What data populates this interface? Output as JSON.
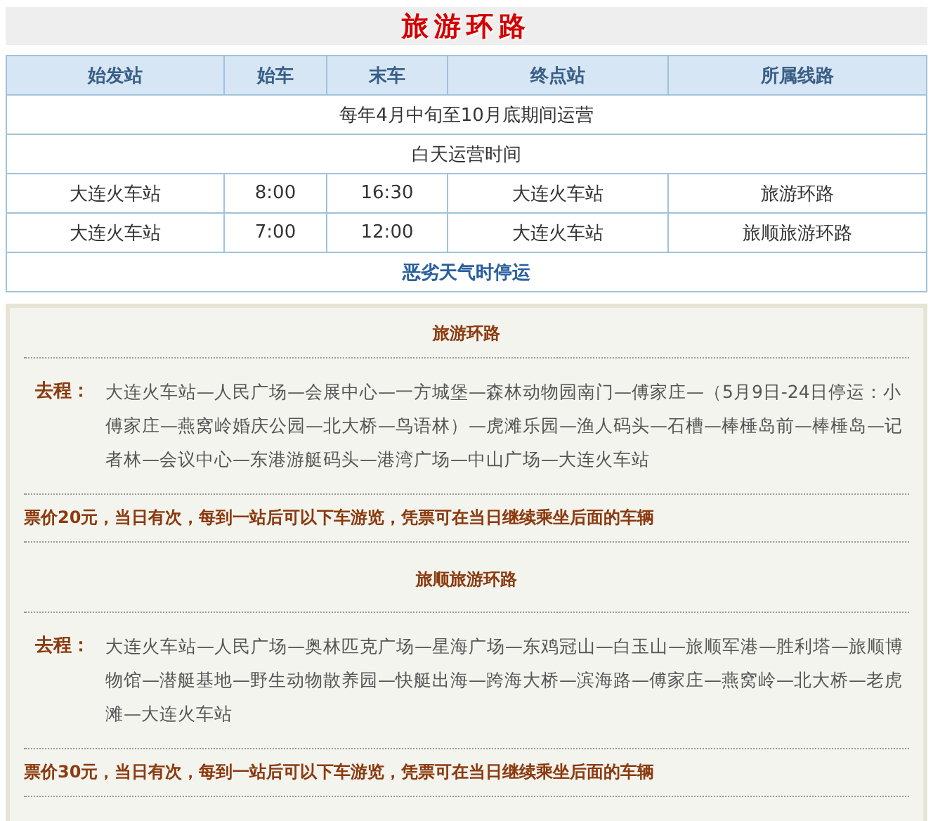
{
  "title": "旅游环路",
  "table": {
    "columns": [
      "始发站",
      "始车",
      "末车",
      "终点站",
      "所属线路"
    ],
    "rows": [
      {
        "kind": "note",
        "text": "每年4月中旬至10月底期间运营"
      },
      {
        "kind": "note",
        "text": "白天运营时间"
      },
      {
        "kind": "schedule",
        "cells": [
          "大连火车站",
          "8:00",
          "16:30",
          "大连火车站",
          "旅游环路"
        ]
      },
      {
        "kind": "schedule",
        "cells": [
          "大连火车站",
          "7:00",
          "12:00",
          "大连火车站",
          "旅顺旅游环路"
        ]
      },
      {
        "kind": "alert",
        "text": "恶劣天气时停运"
      }
    ]
  },
  "routes": [
    {
      "name": "旅游环路",
      "label": "去程：",
      "stops": "大连火车站—人民广场—会展中心—一方城堡—森林动物园南门—傅家庄—（5月9日-24日停运：小傅家庄—燕窝岭婚庆公园—北大桥—鸟语林）—虎滩乐园—渔人码头—石槽—棒棰岛前—棒棰岛—记者林—会议中心—东港游艇码头—港湾广场—中山广场—大连火车站",
      "price": "票价20元，当日有次，每到一站后可以下车游览，凭票可在当日继续乘坐后面的车辆"
    },
    {
      "name": "旅顺旅游环路",
      "label": "去程：",
      "stops": "大连火车站—人民广场—奥林匹克广场—星海广场—东鸡冠山—白玉山—旅顺军港—胜利塔—旅顺博物馆—潜艇基地—野生动物散养园—快艇出海—跨海大桥—滨海路—傅家庄—燕窝岭—北大桥—老虎滩—大连火车站",
      "price": "票价30元，当日有次，每到一站后可以下车游览，凭票可在当日继续乘坐后面的车辆"
    }
  ]
}
